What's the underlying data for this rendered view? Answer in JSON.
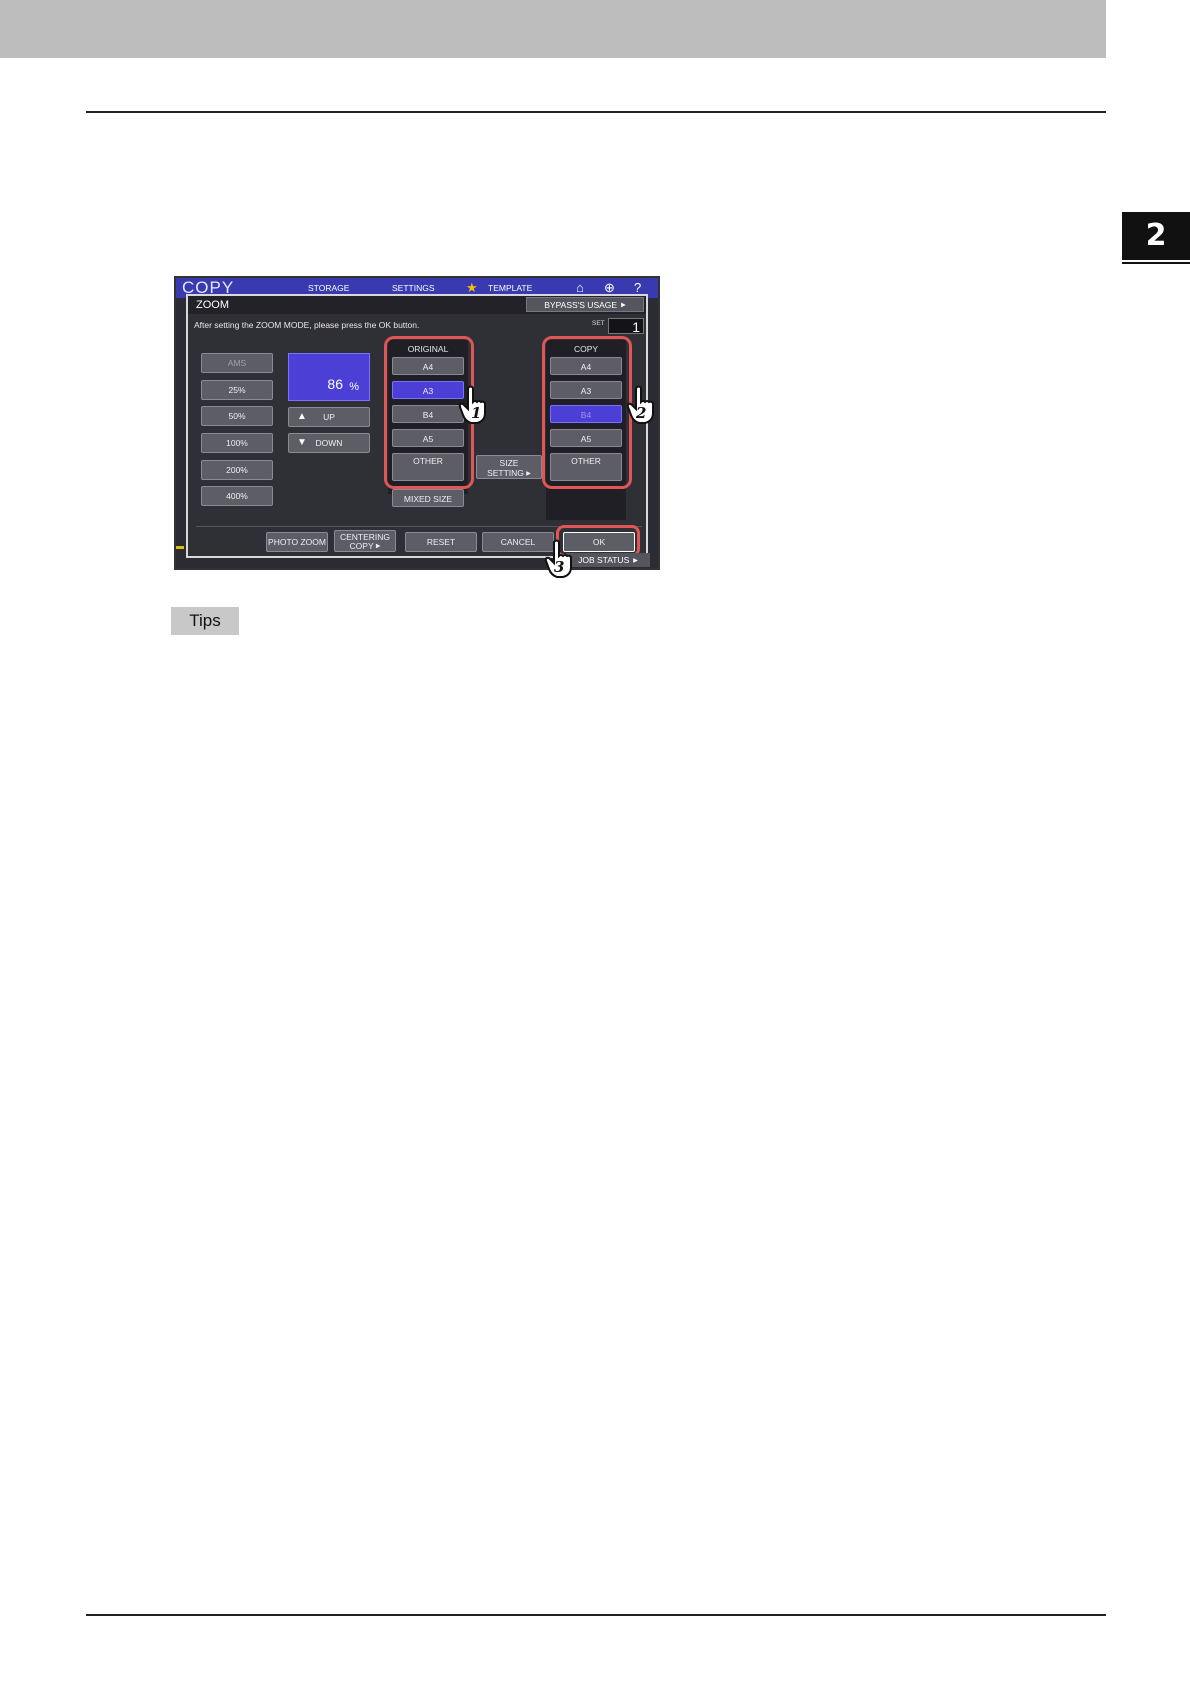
{
  "chapter_number": "2",
  "tips_label": "Tips",
  "screen": {
    "app_title": "COPY",
    "topbar": {
      "storage": "STORAGE",
      "settings": "SETTINGS",
      "template": "TEMPLATE"
    },
    "dialog": {
      "title": "ZOOM",
      "bypass_usage": "BYPASS'S USAGE",
      "instruction": "After setting the ZOOM MODE, please press the OK button.",
      "set_label": "SET",
      "set_value": "1",
      "zoom_presets": [
        "AMS",
        "25%",
        "50%",
        "100%",
        "200%",
        "400%"
      ],
      "zoom_value": "86",
      "zoom_unit": "%",
      "up_label": "UP",
      "down_label": "DOWN",
      "original_label": "ORIGINAL",
      "original_sizes": [
        "A4",
        "A3",
        "B4",
        "A5",
        "OTHER"
      ],
      "original_selected": "A3",
      "mixed_size": "MIXED SIZE",
      "size_setting_line1": "SIZE",
      "size_setting_line2": "SETTING",
      "copy_label": "COPY",
      "copy_sizes": [
        "A4",
        "A3",
        "B4",
        "A5",
        "OTHER"
      ],
      "copy_selected": "B4",
      "photo_zoom": "PHOTO ZOOM",
      "centering_copy_line1": "CENTERING",
      "centering_copy_line2": "COPY",
      "reset": "RESET",
      "cancel": "CANCEL",
      "ok": "OK"
    },
    "job_status": "JOB STATUS",
    "step_callouts": [
      "1",
      "2",
      "3"
    ]
  },
  "colors": {
    "highlight": "#e05555",
    "selected": "#4b3fd6",
    "topbar": "#3a3ab0"
  }
}
